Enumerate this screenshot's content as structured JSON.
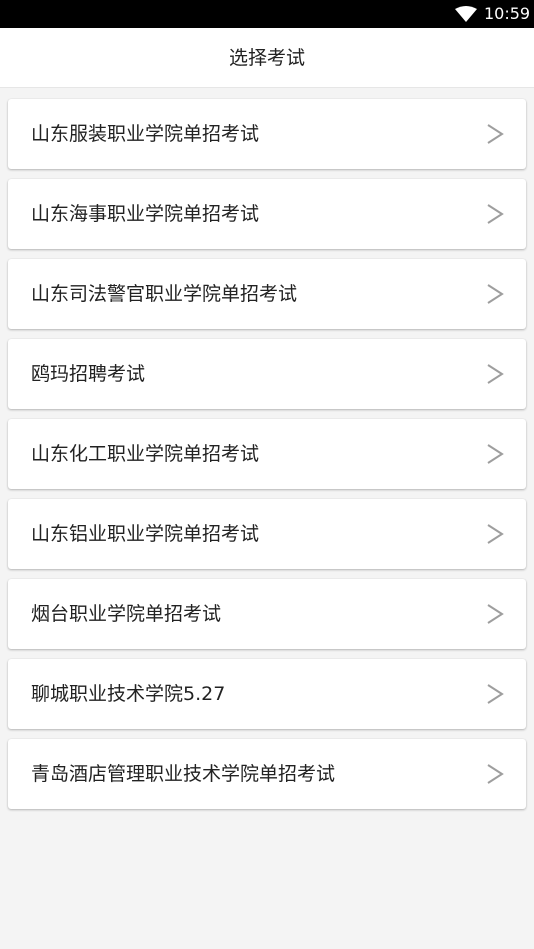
{
  "status_bar": {
    "time": "10:59",
    "wifi_icon": "wifi-icon"
  },
  "header": {
    "title": "选择考试"
  },
  "exams": [
    {
      "label": "山东服装职业学院单招考试"
    },
    {
      "label": "山东海事职业学院单招考试"
    },
    {
      "label": "山东司法警官职业学院单招考试"
    },
    {
      "label": "鸥玛招聘考试"
    },
    {
      "label": "山东化工职业学院单招考试"
    },
    {
      "label": "山东铝业职业学院单招考试"
    },
    {
      "label": "烟台职业学院单招考试"
    },
    {
      "label": "聊城职业技术学院5.27"
    },
    {
      "label": "青岛酒店管理职业技术学院单招考试"
    }
  ],
  "colors": {
    "background": "#f4f4f4",
    "card": "#ffffff",
    "text": "#222222",
    "chevron": "#9e9e9e",
    "status_bar": "#000000"
  }
}
